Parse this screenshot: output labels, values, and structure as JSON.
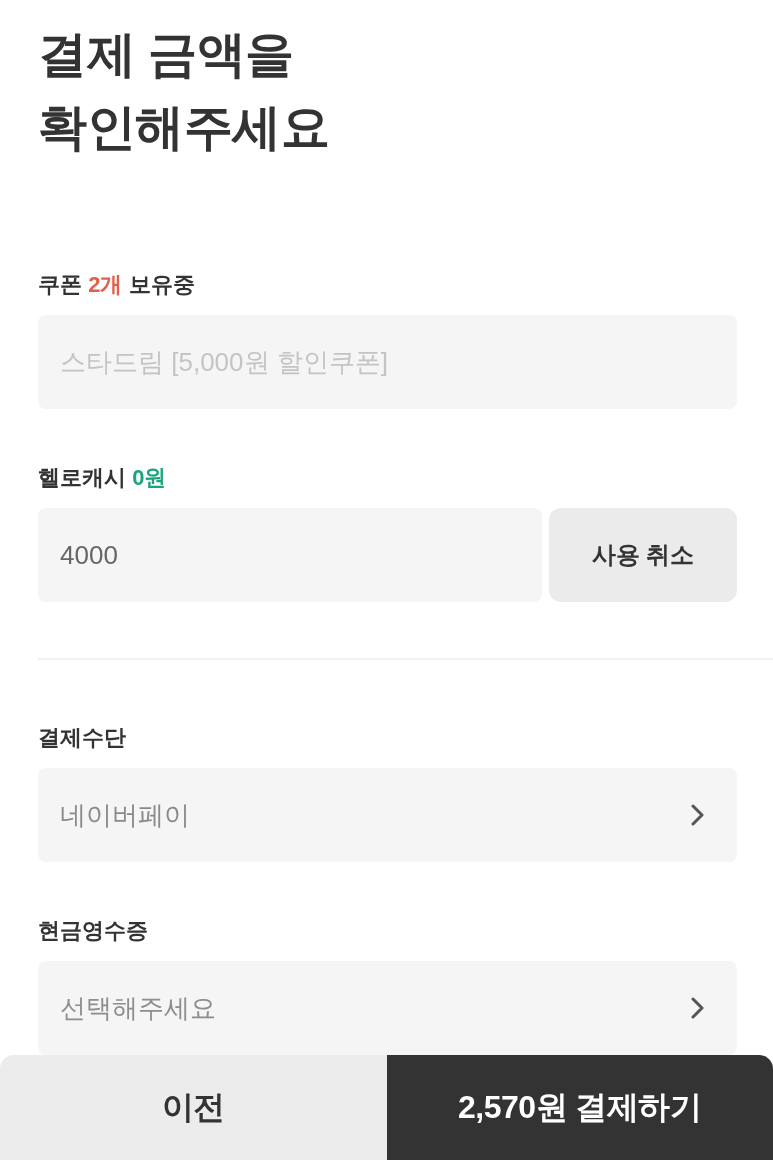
{
  "title": "결제 금액을 확인해주세요",
  "discounts": [
    {
      "kind": "input",
      "label": [
        {
          "text": "쿠폰"
        },
        {
          "text": "2개",
          "color": "#e2604b"
        },
        {
          "text": "보유중"
        }
      ],
      "placeholder": "스타드림 [5,000원 할인쿠폰]"
    },
    {
      "kind": "input-action",
      "label": [
        {
          "text": "헬로캐시"
        },
        {
          "text": "0원",
          "color": "#1ba57f"
        }
      ],
      "value": "4000",
      "action": "사용 취소"
    }
  ],
  "payment": [
    {
      "kind": "select",
      "label": [
        {
          "text": "결제수단"
        }
      ],
      "value": "네이버페이"
    },
    {
      "kind": "select",
      "label": [
        {
          "text": "현금영수증"
        }
      ],
      "placeholder": "선택해주세요"
    }
  ],
  "footer": {
    "buttons": [
      {
        "kind": "secondary",
        "label": "이전"
      },
      {
        "kind": "primary",
        "label": "2,570원 결제하기"
      }
    ]
  }
}
